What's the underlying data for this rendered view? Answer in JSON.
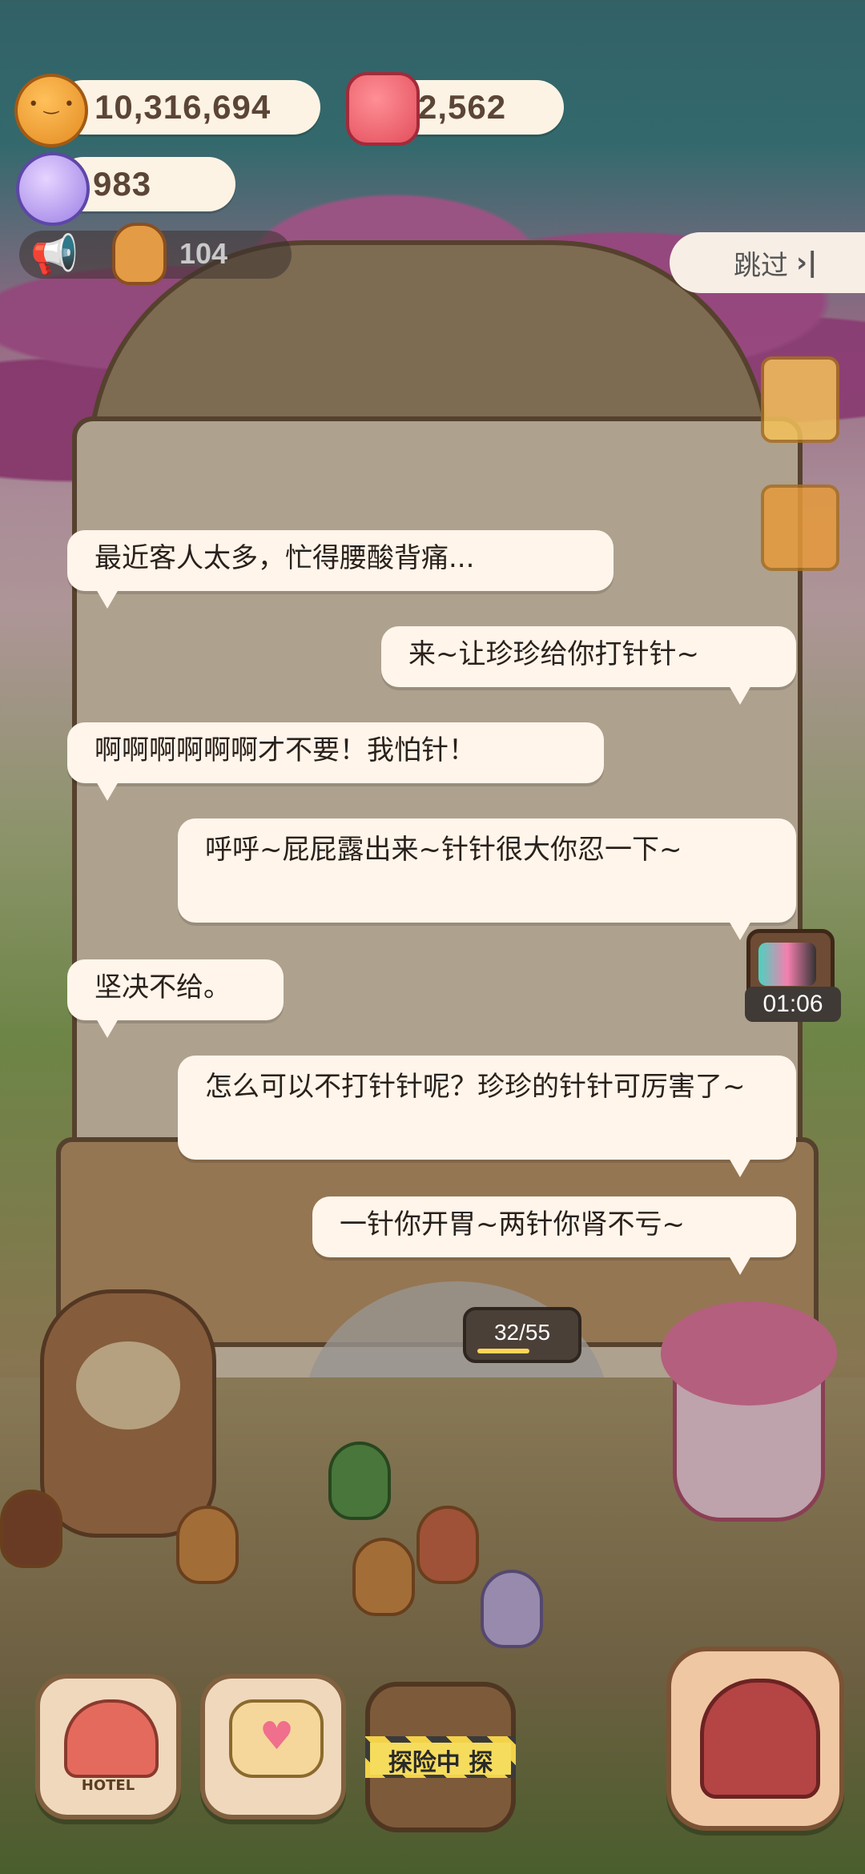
{
  "currencies": {
    "coins": "10,316,694",
    "jelly": "2,562",
    "crystals": "983",
    "cookie_count": "104"
  },
  "skip": {
    "label": "跳过",
    "icon": "skip-icon"
  },
  "dialogue": [
    {
      "text": "最近客人太多，忙得腰酸背痛..."
    },
    {
      "text": "来~让珍珍给你打针针~"
    },
    {
      "text": "啊啊啊啊啊啊才不要！我怕针！"
    },
    {
      "text": "呼呼~屁屁露出来~针针很大你忍一下~"
    },
    {
      "text": "坚决不给。"
    },
    {
      "text": "怎么可以不打针针呢？珍珍的针针可厉害了~"
    },
    {
      "text": "一针你开胃~两针你肾不亏~"
    }
  ],
  "tv_timer": "01:06",
  "progress": {
    "text": "32/55",
    "fraction": 0.58
  },
  "bottom_nav": {
    "hotel_label": "HOTEL",
    "explore_label": "探险中 探"
  },
  "colors": {
    "bubble": "#fff5ea",
    "pill": "#fdf3e4",
    "coin": "#e48b22",
    "jelly": "#e34f5d",
    "gem": "#9c7fe6"
  }
}
